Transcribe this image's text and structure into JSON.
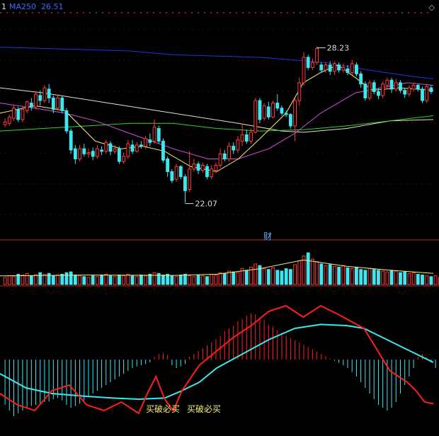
{
  "header": {
    "pane_no": "1",
    "indicator": "MA250",
    "value": "26.51"
  },
  "colors": {
    "up": "#ff3b3b",
    "down": "#3fe6f0",
    "ma250": "#2432e0",
    "ma_yellow": "#f4f07a",
    "ma_magenta": "#d84be0",
    "ma_green": "#32d432",
    "ma_long": "#e8e0c8",
    "macd_red": "#ff1e1e",
    "macd_cyan": "#3fe6f0",
    "grid": "#7a1010",
    "divider": "#b8282e",
    "signal_text": "#f4f07a",
    "label": "#dcdcdc",
    "fin_marker": "#5ab4ff"
  },
  "icons": {
    "corner": "diamond-icon"
  },
  "chart_data": [
    {
      "type": "candlestick",
      "title": "",
      "ylim": [
        21.0,
        29.5
      ],
      "grid": true,
      "annotations": {
        "high": "28.23",
        "low": "22.07",
        "marker": "财"
      },
      "candles": [
        [
          25.15,
          25.25,
          25.05,
          25.4
        ],
        [
          25.2,
          25.45,
          25.1,
          25.55
        ],
        [
          25.4,
          25.8,
          25.3,
          25.9
        ],
        [
          25.75,
          25.35,
          25.25,
          25.85
        ],
        [
          25.35,
          25.75,
          25.25,
          25.85
        ],
        [
          25.7,
          26.05,
          25.6,
          26.1
        ],
        [
          26.0,
          25.85,
          25.7,
          26.2
        ],
        [
          25.85,
          26.35,
          25.75,
          26.45
        ],
        [
          26.3,
          26.1,
          25.9,
          26.5
        ],
        [
          26.1,
          26.6,
          26.0,
          26.7
        ],
        [
          26.55,
          26.2,
          26.0,
          26.75
        ],
        [
          26.2,
          25.75,
          25.6,
          26.3
        ],
        [
          25.8,
          26.2,
          25.7,
          26.3
        ],
        [
          26.2,
          25.7,
          25.6,
          26.3
        ],
        [
          25.7,
          24.9,
          24.8,
          25.8
        ],
        [
          24.9,
          24.15,
          24.0,
          25.0
        ],
        [
          24.2,
          23.8,
          23.6,
          24.35
        ],
        [
          23.8,
          24.2,
          23.7,
          24.35
        ],
        [
          24.2,
          24.0,
          23.9,
          24.4
        ],
        [
          24.0,
          24.05,
          23.85,
          24.2
        ],
        [
          24.1,
          23.9,
          23.75,
          24.25
        ],
        [
          23.9,
          24.2,
          23.8,
          24.35
        ],
        [
          24.15,
          24.1,
          23.95,
          24.3
        ],
        [
          24.1,
          24.45,
          24.0,
          24.55
        ],
        [
          24.4,
          24.1,
          23.95,
          24.5
        ],
        [
          24.1,
          24.2,
          24.0,
          24.35
        ],
        [
          24.2,
          23.7,
          23.6,
          24.3
        ],
        [
          23.7,
          23.9,
          23.6,
          24.05
        ],
        [
          23.9,
          24.4,
          23.8,
          24.55
        ],
        [
          24.35,
          24.1,
          24.0,
          24.55
        ],
        [
          24.1,
          24.35,
          24.05,
          24.45
        ],
        [
          24.35,
          24.3,
          24.2,
          24.5
        ],
        [
          24.3,
          24.6,
          24.2,
          24.7
        ],
        [
          24.55,
          24.45,
          24.3,
          24.8
        ],
        [
          24.5,
          25.05,
          24.4,
          25.35
        ],
        [
          25.0,
          24.5,
          24.4,
          25.1
        ],
        [
          24.5,
          23.75,
          23.65,
          24.6
        ],
        [
          23.8,
          23.3,
          23.1,
          23.9
        ],
        [
          23.3,
          22.95,
          22.85,
          23.4
        ],
        [
          23.0,
          23.5,
          22.9,
          23.6
        ],
        [
          23.5,
          23.1,
          23.0,
          23.55
        ],
        [
          23.1,
          22.55,
          22.07,
          23.2
        ],
        [
          22.6,
          23.4,
          22.5,
          24.1
        ],
        [
          23.4,
          23.6,
          23.3,
          23.8
        ],
        [
          23.6,
          23.35,
          23.2,
          23.7
        ],
        [
          23.35,
          23.55,
          23.25,
          23.65
        ],
        [
          23.5,
          23.1,
          23.0,
          23.6
        ],
        [
          23.1,
          23.4,
          23.0,
          23.55
        ],
        [
          23.35,
          23.55,
          23.25,
          23.65
        ],
        [
          23.55,
          24.0,
          23.45,
          24.2
        ],
        [
          24.0,
          23.8,
          23.7,
          24.15
        ],
        [
          23.8,
          24.3,
          23.7,
          24.45
        ],
        [
          24.3,
          24.15,
          24.0,
          24.45
        ],
        [
          24.15,
          24.55,
          24.05,
          24.7
        ],
        [
          24.5,
          24.75,
          24.3,
          25.2
        ],
        [
          24.75,
          24.5,
          24.4,
          24.95
        ],
        [
          24.5,
          24.85,
          24.4,
          25.0
        ],
        [
          24.85,
          26.1,
          24.8,
          26.2
        ],
        [
          26.1,
          25.35,
          25.2,
          26.2
        ],
        [
          25.4,
          25.9,
          25.3,
          26.0
        ],
        [
          25.85,
          25.45,
          25.35,
          26.05
        ],
        [
          25.45,
          26.0,
          25.4,
          26.1
        ],
        [
          26.0,
          25.8,
          25.7,
          26.35
        ],
        [
          25.8,
          25.6,
          25.5,
          25.9
        ],
        [
          25.6,
          25.55,
          25.45,
          25.7
        ],
        [
          25.55,
          25.1,
          25.0,
          25.6
        ],
        [
          25.1,
          26.1,
          24.5,
          26.2
        ],
        [
          26.1,
          26.8,
          25.9,
          27.0
        ],
        [
          26.8,
          27.8,
          26.7,
          28.0
        ],
        [
          27.8,
          27.4,
          27.3,
          27.9
        ],
        [
          27.4,
          27.6,
          27.3,
          27.75
        ],
        [
          27.6,
          28.15,
          27.5,
          28.23
        ],
        [
          27.5,
          27.3,
          27.2,
          27.6
        ],
        [
          27.3,
          27.5,
          27.2,
          27.6
        ],
        [
          27.5,
          27.25,
          27.1,
          27.65
        ],
        [
          27.25,
          27.55,
          27.1,
          27.65
        ],
        [
          27.5,
          27.3,
          27.2,
          27.6
        ],
        [
          27.3,
          27.4,
          27.2,
          27.55
        ],
        [
          27.35,
          27.2,
          27.1,
          27.5
        ],
        [
          27.2,
          27.55,
          27.1,
          27.7
        ],
        [
          27.5,
          27.15,
          27.05,
          27.6
        ],
        [
          27.15,
          26.75,
          26.6,
          27.25
        ],
        [
          26.75,
          26.2,
          26.1,
          26.85
        ],
        [
          26.2,
          26.8,
          26.1,
          26.9
        ],
        [
          26.8,
          26.45,
          26.35,
          26.9
        ],
        [
          26.45,
          26.3,
          26.15,
          26.6
        ],
        [
          26.3,
          26.75,
          26.2,
          26.85
        ],
        [
          26.7,
          26.9,
          26.55,
          27.0
        ],
        [
          26.9,
          26.55,
          26.4,
          27.0
        ],
        [
          26.55,
          26.8,
          26.45,
          26.95
        ],
        [
          26.8,
          26.5,
          26.4,
          26.9
        ],
        [
          26.5,
          26.35,
          26.2,
          26.6
        ],
        [
          26.35,
          26.6,
          26.25,
          26.7
        ],
        [
          26.55,
          26.7,
          26.45,
          26.8
        ],
        [
          26.7,
          26.55,
          26.45,
          26.75
        ],
        [
          26.55,
          26.1,
          26.0,
          26.65
        ],
        [
          26.1,
          26.65,
          26.0,
          26.75
        ],
        [
          26.6,
          26.45,
          26.35,
          26.7
        ]
      ],
      "lines": [
        {
          "key": "ma250",
          "points": [
            [
              0,
              28.2
            ],
            [
              30,
              28.05
            ],
            [
              40,
              27.9
            ],
            [
              60,
              27.8
            ],
            [
              75,
              27.6
            ],
            [
              85,
              27.3
            ],
            [
              95,
              27.05
            ],
            [
              100,
              26.95
            ]
          ]
        },
        {
          "key": "ma_long",
          "points": [
            [
              0,
              26.6
            ],
            [
              10,
              26.4
            ],
            [
              25,
              26.0
            ],
            [
              40,
              25.6
            ],
            [
              55,
              25.2
            ],
            [
              65,
              24.9
            ],
            [
              70,
              24.85
            ],
            [
              80,
              25.0
            ],
            [
              90,
              25.3
            ],
            [
              100,
              25.35
            ]
          ]
        },
        {
          "key": "ma_magenta",
          "points": [
            [
              0,
              26.0
            ],
            [
              8,
              25.8
            ],
            [
              15,
              25.6
            ],
            [
              22,
              25.3
            ],
            [
              30,
              24.8
            ],
            [
              40,
              24.2
            ],
            [
              48,
              23.8
            ],
            [
              55,
              23.8
            ],
            [
              62,
              24.2
            ],
            [
              68,
              24.8
            ],
            [
              74,
              25.6
            ],
            [
              82,
              26.4
            ],
            [
              88,
              26.6
            ],
            [
              94,
              26.8
            ],
            [
              100,
              26.7
            ]
          ]
        },
        {
          "key": "ma_green",
          "points": [
            [
              0,
              24.9
            ],
            [
              10,
              25.0
            ],
            [
              20,
              25.1
            ],
            [
              30,
              25.2
            ],
            [
              40,
              25.2
            ],
            [
              50,
              25.0
            ],
            [
              60,
              24.9
            ],
            [
              70,
              24.95
            ],
            [
              80,
              25.1
            ],
            [
              90,
              25.3
            ],
            [
              100,
              25.5
            ]
          ]
        },
        {
          "key": "ma_yellow",
          "points": [
            [
              0,
              25.6
            ],
            [
              8,
              25.9
            ],
            [
              15,
              25.7
            ],
            [
              22,
              24.5
            ],
            [
              28,
              24.2
            ],
            [
              33,
              24.3
            ],
            [
              38,
              24.1
            ],
            [
              44,
              23.5
            ],
            [
              50,
              23.3
            ],
            [
              55,
              23.8
            ],
            [
              60,
              24.6
            ],
            [
              66,
              25.6
            ],
            [
              70,
              26.8
            ],
            [
              74,
              27.2
            ],
            [
              78,
              27.5
            ],
            [
              82,
              27.0
            ],
            [
              86,
              26.5
            ],
            [
              92,
              26.6
            ],
            [
              100,
              26.5
            ]
          ]
        }
      ]
    },
    {
      "type": "bar",
      "title": "",
      "ylim": [
        0,
        100
      ],
      "values": [
        18,
        22,
        20,
        26,
        24,
        28,
        22,
        25,
        30,
        26,
        28,
        22,
        24,
        26,
        30,
        32,
        24,
        22,
        20,
        18,
        22,
        20,
        24,
        26,
        22,
        20,
        24,
        22,
        26,
        22,
        20,
        24,
        22,
        26,
        30,
        28,
        24,
        26,
        22,
        20,
        24,
        26,
        22,
        20,
        24,
        22,
        20,
        26,
        24,
        30,
        28,
        34,
        32,
        30,
        40,
        36,
        44,
        52,
        48,
        40,
        38,
        42,
        36,
        34,
        40,
        38,
        50,
        60,
        72,
        80,
        64,
        58,
        52,
        48,
        50,
        46,
        44,
        48,
        42,
        40,
        44,
        38,
        36,
        40,
        38,
        36,
        34,
        32,
        36,
        34,
        30,
        32,
        28,
        30,
        26,
        24,
        22,
        20,
        22,
        18
      ],
      "ma": [
        [
          0,
          22
        ],
        [
          20,
          24
        ],
        [
          40,
          23
        ],
        [
          50,
          26
        ],
        [
          60,
          40
        ],
        [
          70,
          62
        ],
        [
          80,
          46
        ],
        [
          90,
          36
        ],
        [
          100,
          28
        ]
      ]
    },
    {
      "type": "line",
      "title": "",
      "ylim": [
        -1.1,
        1.1
      ],
      "signals": [
        "买破必买",
        "买破必买"
      ],
      "histogram": [
        -0.8,
        -0.9,
        -1.0,
        -0.95,
        -0.9,
        -0.85,
        -0.82,
        -0.8,
        -0.78,
        -0.75,
        -0.74,
        -0.7,
        -0.68,
        -0.72,
        -0.8,
        -0.85,
        -0.82,
        -0.78,
        -0.72,
        -0.65,
        -0.6,
        -0.55,
        -0.5,
        -0.45,
        -0.4,
        -0.35,
        -0.3,
        -0.25,
        -0.2,
        -0.15,
        -0.12,
        -0.1,
        -0.08,
        -0.05,
        0.05,
        0.1,
        0.12,
        0.08,
        -0.1,
        -0.15,
        -0.12,
        -0.08,
        0.05,
        0.1,
        0.15,
        0.2,
        0.25,
        0.3,
        0.36,
        0.42,
        0.5,
        0.55,
        0.6,
        0.68,
        0.72,
        0.78,
        0.82,
        0.8,
        0.74,
        0.7,
        0.62,
        0.58,
        0.52,
        0.48,
        0.42,
        0.38,
        0.34,
        0.3,
        0.26,
        0.22,
        0.18,
        0.14,
        0.1,
        0.06,
        0.02,
        -0.02,
        -0.06,
        -0.1,
        -0.15,
        -0.22,
        -0.3,
        -0.4,
        -0.5,
        -0.6,
        -0.7,
        -0.8,
        -0.85,
        -0.9,
        -0.85,
        -0.75,
        -0.6,
        -0.45,
        -0.3,
        -0.15,
        0.05,
        0.1,
        0.05,
        -0.05,
        -0.15,
        -0.25
      ],
      "dif": [
        [
          0,
          -0.6
        ],
        [
          4,
          -0.8
        ],
        [
          8,
          -0.9
        ],
        [
          12,
          -0.55
        ],
        [
          16,
          -0.45
        ],
        [
          20,
          -0.8
        ],
        [
          24,
          -0.9
        ],
        [
          28,
          -0.75
        ],
        [
          32,
          -0.95
        ],
        [
          34,
          -0.6
        ],
        [
          36,
          -0.3
        ],
        [
          38,
          -0.7
        ],
        [
          40,
          -0.9
        ],
        [
          42,
          -0.55
        ],
        [
          46,
          -0.1
        ],
        [
          50,
          0.15
        ],
        [
          54,
          0.4
        ],
        [
          58,
          0.6
        ],
        [
          62,
          0.85
        ],
        [
          66,
          0.95
        ],
        [
          70,
          0.75
        ],
        [
          74,
          0.95
        ],
        [
          78,
          0.8
        ],
        [
          84,
          0.55
        ],
        [
          86,
          0.3
        ],
        [
          90,
          -0.2
        ],
        [
          94,
          -0.4
        ],
        [
          96,
          -0.55
        ],
        [
          98,
          -0.75
        ],
        [
          100,
          -0.78
        ]
      ],
      "dea": [
        [
          0,
          -0.25
        ],
        [
          6,
          -0.5
        ],
        [
          12,
          -0.6
        ],
        [
          20,
          -0.65
        ],
        [
          26,
          -0.68
        ],
        [
          32,
          -0.7
        ],
        [
          38,
          -0.68
        ],
        [
          42,
          -0.55
        ],
        [
          46,
          -0.4
        ],
        [
          50,
          -0.15
        ],
        [
          56,
          0.1
        ],
        [
          62,
          0.35
        ],
        [
          68,
          0.55
        ],
        [
          74,
          0.62
        ],
        [
          80,
          0.6
        ],
        [
          84,
          0.55
        ],
        [
          88,
          0.4
        ],
        [
          92,
          0.25
        ],
        [
          96,
          0.1
        ],
        [
          100,
          -0.05
        ]
      ]
    }
  ]
}
